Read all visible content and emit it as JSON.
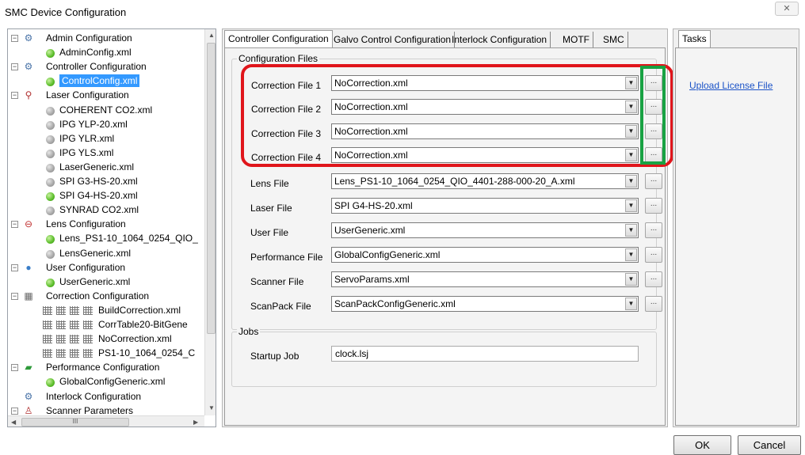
{
  "window": {
    "title": "SMC Device Configuration",
    "close": "✕"
  },
  "tree": {
    "items": [
      {
        "label": "Admin Configuration",
        "type": "group",
        "icon": "gears-icon"
      },
      {
        "label": "AdminConfig.xml",
        "type": "leaf",
        "icon": "green-status-icon"
      },
      {
        "label": "Controller Configuration",
        "type": "group",
        "icon": "gears-icon"
      },
      {
        "label": "ControlConfig.xml",
        "type": "leaf",
        "icon": "green-status-icon",
        "selected": true
      },
      {
        "label": "Laser Configuration",
        "type": "group",
        "icon": "laser-icon"
      },
      {
        "label": "COHERENT CO2.xml",
        "type": "leaf",
        "icon": "gray-status-icon"
      },
      {
        "label": "IPG YLP-20.xml",
        "type": "leaf",
        "icon": "gray-status-icon"
      },
      {
        "label": "IPG YLR.xml",
        "type": "leaf",
        "icon": "gray-status-icon"
      },
      {
        "label": "IPG YLS.xml",
        "type": "leaf",
        "icon": "gray-status-icon"
      },
      {
        "label": "LaserGeneric.xml",
        "type": "leaf",
        "icon": "gray-status-icon"
      },
      {
        "label": "SPI G3-HS-20.xml",
        "type": "leaf",
        "icon": "gray-status-icon"
      },
      {
        "label": "SPI G4-HS-20.xml",
        "type": "leaf",
        "icon": "green-status-icon"
      },
      {
        "label": "SYNRAD CO2.xml",
        "type": "leaf",
        "icon": "gray-status-icon"
      },
      {
        "label": "Lens Configuration",
        "type": "group",
        "icon": "lens-icon"
      },
      {
        "label": "Lens_PS1-10_1064_0254_QIO_",
        "type": "leaf",
        "icon": "green-status-icon"
      },
      {
        "label": "LensGeneric.xml",
        "type": "leaf",
        "icon": "gray-status-icon"
      },
      {
        "label": "User Configuration",
        "type": "group",
        "icon": "user-icon"
      },
      {
        "label": "UserGeneric.xml",
        "type": "leaf",
        "icon": "green-status-icon"
      },
      {
        "label": "Correction Configuration",
        "type": "group",
        "icon": "grid-icon"
      },
      {
        "label": "BuildCorrection.xml",
        "type": "corr",
        "icon": "correction-grid-icon"
      },
      {
        "label": "CorrTable20-BitGene",
        "type": "corr",
        "icon": "correction-grid-icon"
      },
      {
        "label": "NoCorrection.xml",
        "type": "corr",
        "icon": "numbered-grid-icon"
      },
      {
        "label": "PS1-10_1064_0254_C",
        "type": "corr",
        "icon": "correction-grid-icon"
      },
      {
        "label": "Performance Configuration",
        "type": "group",
        "icon": "performance-chart-icon"
      },
      {
        "label": "GlobalConfigGeneric.xml",
        "type": "leaf",
        "icon": "green-status-icon"
      },
      {
        "label": "Interlock Configuration",
        "type": "group-noexp",
        "icon": "gears-icon"
      },
      {
        "label": "Scanner Parameters",
        "type": "group",
        "icon": "scanner-icon"
      }
    ],
    "hscroll_grip": "III"
  },
  "tabs": [
    "Controller Configuration",
    "Galvo Control Configuration",
    "Interlock Configuration",
    "MOTF",
    "SMC"
  ],
  "config_files": {
    "legend": "Configuration Files",
    "rows": [
      {
        "label": "Correction File 1",
        "value": "NoCorrection.xml"
      },
      {
        "label": "Correction File 2",
        "value": "NoCorrection.xml"
      },
      {
        "label": "Correction File 3",
        "value": "NoCorrection.xml"
      },
      {
        "label": "Correction File 4",
        "value": "NoCorrection.xml"
      },
      {
        "label": "Lens File",
        "value": "Lens_PS1-10_1064_0254_QIO_4401-288-000-20_A.xml"
      },
      {
        "label": "Laser File",
        "value": "SPI G4-HS-20.xml"
      },
      {
        "label": "User File",
        "value": "UserGeneric.xml"
      },
      {
        "label": "Performance File",
        "value": "GlobalConfigGeneric.xml"
      },
      {
        "label": "Scanner File",
        "value": "ServoParams.xml"
      },
      {
        "label": "ScanPack File",
        "value": "ScanPackConfigGeneric.xml"
      }
    ],
    "browse_label": "..."
  },
  "jobs": {
    "legend": "Jobs",
    "startup_label": "Startup Job",
    "startup_value": "clock.lsj"
  },
  "tasks": {
    "tab": "Tasks",
    "link": "Upload License File"
  },
  "buttons": {
    "ok": "OK",
    "cancel": "Cancel"
  },
  "colors": {
    "highlight_red": "#e0151b",
    "highlight_green": "#19a243",
    "selection": "#3399ff",
    "link": "#1a52c7"
  }
}
